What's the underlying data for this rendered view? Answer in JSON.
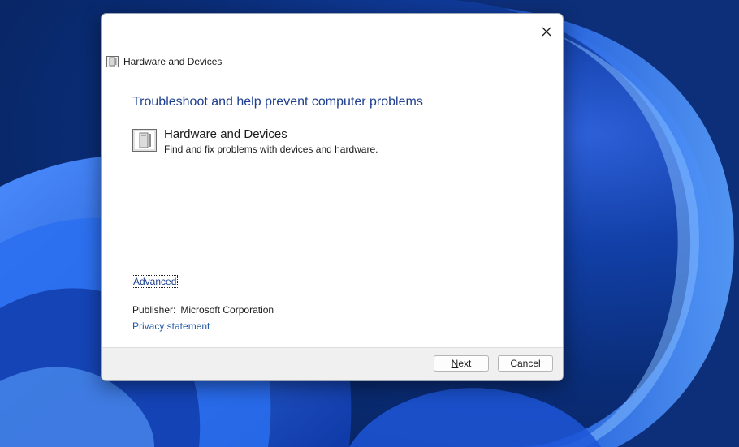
{
  "colors": {
    "heading": "#1e3f8f",
    "link": "#1e5aa8",
    "footer_bg": "#f0f0f0",
    "desktop_bg": "#0a2d78"
  },
  "dialog": {
    "window_title": "Hardware and Devices",
    "close_icon": "close-icon",
    "heading": "Troubleshoot and help prevent computer problems",
    "item": {
      "icon": "hardware-device-icon",
      "title": "Hardware and Devices",
      "description": "Find and fix problems with devices and hardware."
    },
    "advanced_label": "Advanced",
    "publisher_label": "Publisher:",
    "publisher_value": "Microsoft Corporation",
    "privacy_label": "Privacy statement",
    "buttons": {
      "next_prefix": "",
      "next_mnemonic": "N",
      "next_suffix": "ext",
      "cancel": "Cancel"
    }
  }
}
